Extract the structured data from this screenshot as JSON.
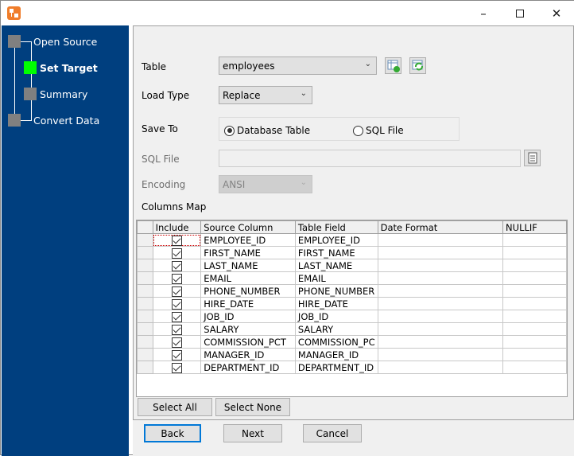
{
  "window": {
    "icon": "app-icon",
    "controls": [
      "minimize",
      "maximize",
      "close"
    ]
  },
  "steps": [
    {
      "label": "Open Source",
      "active": false
    },
    {
      "label": "Set Target",
      "active": true
    },
    {
      "label": "Summary",
      "active": false
    },
    {
      "label": "Convert Data",
      "active": false
    }
  ],
  "colors": {
    "sidebar": "#003f7f",
    "active_step": "#00ff00",
    "inactive_step": "#808080",
    "focus": "#0078d7"
  },
  "form": {
    "table_label": "Table",
    "table_value": "employees",
    "load_type_label": "Load Type",
    "load_type_value": "Replace",
    "save_to_label": "Save To",
    "save_to_options": [
      "Database Table",
      "SQL File"
    ],
    "save_to_selected": "Database Table",
    "sql_file_label": "SQL File",
    "sql_file_value": "",
    "encoding_label": "Encoding",
    "encoding_value": "ANSI",
    "columns_map_label": "Columns Map"
  },
  "grid": {
    "headers": [
      "Include",
      "Source Column",
      "Table Field",
      "Date Format",
      "NULLIF"
    ],
    "rows": [
      {
        "include": true,
        "source": "EMPLOYEE_ID",
        "field": "EMPLOYEE_ID",
        "date_format": "",
        "nullif": ""
      },
      {
        "include": true,
        "source": "FIRST_NAME",
        "field": "FIRST_NAME",
        "date_format": "",
        "nullif": ""
      },
      {
        "include": true,
        "source": "LAST_NAME",
        "field": "LAST_NAME",
        "date_format": "",
        "nullif": ""
      },
      {
        "include": true,
        "source": "EMAIL",
        "field": "EMAIL",
        "date_format": "",
        "nullif": ""
      },
      {
        "include": true,
        "source": "PHONE_NUMBER",
        "field": "PHONE_NUMBER",
        "date_format": "",
        "nullif": ""
      },
      {
        "include": true,
        "source": "HIRE_DATE",
        "field": "HIRE_DATE",
        "date_format": "",
        "nullif": ""
      },
      {
        "include": true,
        "source": "JOB_ID",
        "field": "JOB_ID",
        "date_format": "",
        "nullif": ""
      },
      {
        "include": true,
        "source": "SALARY",
        "field": "SALARY",
        "date_format": "",
        "nullif": ""
      },
      {
        "include": true,
        "source": "COMMISSION_PCT",
        "field": "COMMISSION_PC",
        "date_format": "",
        "nullif": ""
      },
      {
        "include": true,
        "source": "MANAGER_ID",
        "field": "MANAGER_ID",
        "date_format": "",
        "nullif": ""
      },
      {
        "include": true,
        "source": "DEPARTMENT_ID",
        "field": "DEPARTMENT_ID",
        "date_format": "",
        "nullif": ""
      }
    ]
  },
  "buttons": {
    "select_all": "Select All",
    "select_none": "Select None",
    "back": "Back",
    "next": "Next",
    "cancel": "Cancel"
  }
}
